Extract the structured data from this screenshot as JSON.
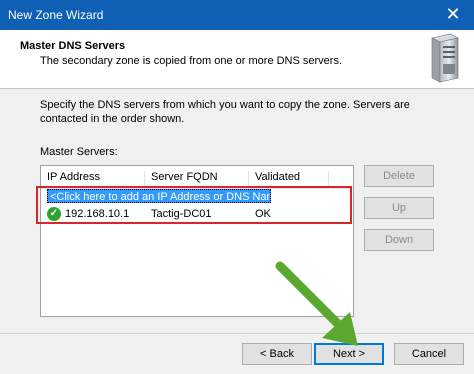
{
  "window": {
    "title": "New Zone Wizard",
    "close_glyph": "✕"
  },
  "header": {
    "title": "Master DNS Servers",
    "subtitle": "The secondary zone is copied from one or more DNS servers.",
    "icon": "server-icon"
  },
  "body": {
    "intro": "Specify the DNS servers from which you want to copy the zone.  Servers are contacted in the order shown.",
    "list_label": "Master Servers:"
  },
  "table": {
    "columns": [
      "IP Address",
      "Server FQDN",
      "Validated"
    ],
    "add_prompt": "<Click here to add an IP Address or DNS Name>",
    "rows": [
      {
        "status_icon": "check-icon",
        "ip": "192.168.10.1",
        "fqdn": "Tactig-DC01",
        "validated": "OK"
      }
    ]
  },
  "side_buttons": {
    "delete": "Delete",
    "up": "Up",
    "down": "Down"
  },
  "footer": {
    "back": "< Back",
    "next": "Next >",
    "cancel": "Cancel"
  },
  "colors": {
    "titlebar": "#0f5fb5",
    "highlight": "#d9262c",
    "arrow": "#5aa832",
    "selection": "#3399ff"
  }
}
